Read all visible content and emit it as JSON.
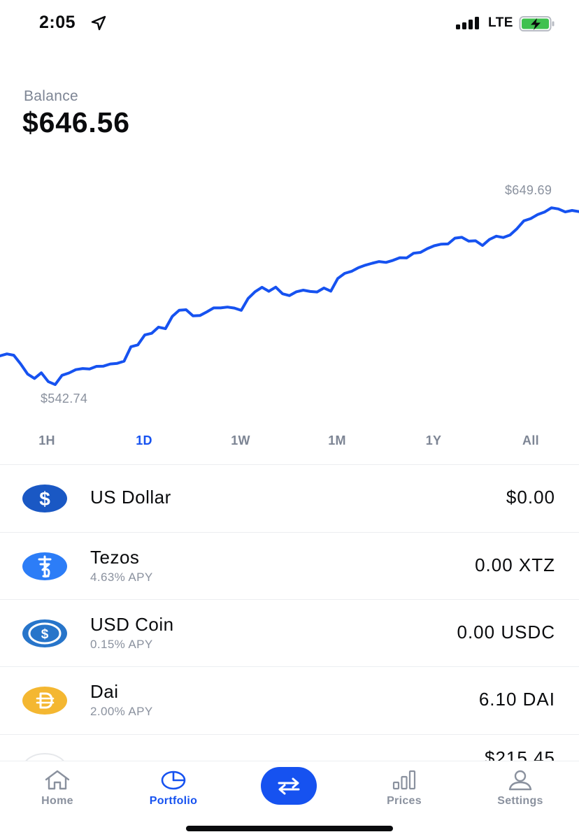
{
  "status_bar": {
    "time": "2:05",
    "network": "LTE"
  },
  "balance": {
    "label": "Balance",
    "value": "$646.56"
  },
  "chart": {
    "high_label": "$649.69",
    "low_label": "$542.74"
  },
  "chart_data": {
    "type": "line",
    "series": [
      {
        "values": [
          560.0,
          561.2,
          560.4,
          555.1,
          549.1,
          546.4,
          549.8,
          544.5,
          542.7,
          548.3,
          549.7,
          551.7,
          552.4,
          552.1,
          553.7,
          553.8,
          555.1,
          555.5,
          556.8,
          565.5,
          566.6,
          572.6,
          573.6,
          577.3,
          576.4,
          583.8,
          587.5,
          587.8,
          584.1,
          584.3,
          586.5,
          588.9,
          588.9,
          589.4,
          588.8,
          587.4,
          594.6,
          598.6,
          601.3,
          598.9,
          601.4,
          597.4,
          596.3,
          598.6,
          599.6,
          598.8,
          598.5,
          600.9,
          599.0,
          606.6,
          609.7,
          610.9,
          613.1,
          614.6,
          615.8,
          616.8,
          616.3,
          617.5,
          619.1,
          619.0,
          621.8,
          622.3,
          624.6,
          626.3,
          627.3,
          627.4,
          630.9,
          631.4,
          629.1,
          629.3,
          626.5,
          630.1,
          632.1,
          631.3,
          632.8,
          636.6,
          641.3,
          642.7,
          645.1,
          646.6,
          649.2,
          648.5,
          646.7,
          647.6,
          646.9
        ]
      }
    ],
    "ylim": [
      542.74,
      649.69
    ],
    "grid": false,
    "range_options": [
      "1H",
      "1D",
      "1W",
      "1M",
      "1Y",
      "All"
    ],
    "selected_range": "1D",
    "line_color": "#1652f0"
  },
  "assets": [
    {
      "name": "US Dollar",
      "sub": "",
      "amount": "$0.00",
      "icon": "dollar-icon",
      "color": "#1a58c4"
    },
    {
      "name": "Tezos",
      "sub": "4.63% APY",
      "amount": "0.00 XTZ",
      "icon": "tezos-icon",
      "color": "#2c7df7"
    },
    {
      "name": "USD Coin",
      "sub": "0.15% APY",
      "amount": "0.00 USDC",
      "icon": "usd-coin-icon",
      "color": "#2775ca"
    },
    {
      "name": "Dai",
      "sub": "2.00% APY",
      "amount": "6.10 DAI",
      "icon": "dai-icon",
      "color": "#f4b731"
    },
    {
      "name": "",
      "sub": "",
      "amount": "$215.45",
      "icon": "coin-icon",
      "color": "#ffffff"
    }
  ],
  "bottom_nav": {
    "items": [
      {
        "label": "Home",
        "icon": "home-icon"
      },
      {
        "label": "Portfolio",
        "icon": "pie-chart-icon"
      },
      {
        "label": "Prices",
        "icon": "bar-chart-icon"
      },
      {
        "label": "Settings",
        "icon": "person-icon"
      }
    ],
    "active": "Portfolio",
    "trade_icon": "swap-arrows-icon"
  }
}
